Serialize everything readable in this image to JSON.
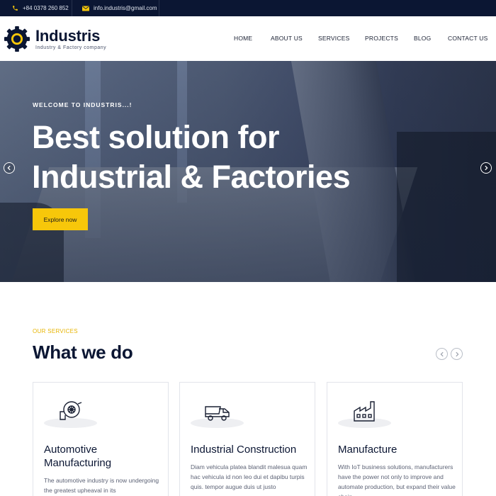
{
  "topbar": {
    "phone": "+84 0378 260 852",
    "email": "info.industris@gmail.com",
    "phone_icon": "phone-icon",
    "email_icon": "mail-icon"
  },
  "brand": {
    "name": "Industris",
    "tagline": "Industry & Factory company",
    "logo_icon": "gear-logo-icon"
  },
  "nav": {
    "items": [
      "HOME",
      "ABOUT US",
      "SERVICES",
      "PROJECTS",
      "BLOG",
      "CONTACT US"
    ]
  },
  "hero": {
    "kicker": "WELCOME TO INDUSTRIS...!",
    "title_line1": "Best solution for",
    "title_line2": "Industrial & Factories",
    "button": "Explore now"
  },
  "services": {
    "kicker": "OUR SERVICES",
    "title": "What we do",
    "cards": [
      {
        "icon": "turbine-icon",
        "title": "Automotive Manufacturing",
        "text": "The automotive industry is now undergoing the greatest upheaval in its"
      },
      {
        "icon": "dump-truck-icon",
        "title": "Industrial Construction",
        "text": "Diam vehicula platea blandit malesua quam hac vehicula id non leo dui et dapibu turpis quis. tempor augue duis ut justo"
      },
      {
        "icon": "factory-icon",
        "title": "Manufacture",
        "text": "With IoT business solutions, manufacturers have the power not only to improve and automate production, but expand their value chain"
      }
    ]
  },
  "colors": {
    "topbar_bg": "#0b1633",
    "accent": "#f7c70a",
    "heading": "#0b1633"
  }
}
